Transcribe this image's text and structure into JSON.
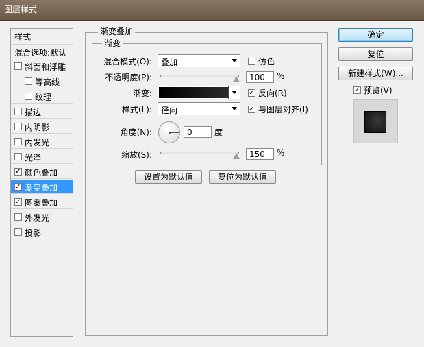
{
  "window": {
    "title": "图层样式"
  },
  "left_panel": {
    "items": [
      {
        "label": "样式",
        "type": "header"
      },
      {
        "label": "混合选项:默认",
        "type": "header"
      },
      {
        "label": "斜面和浮雕",
        "checked": false
      },
      {
        "label": "等高线",
        "checked": false,
        "indent": true
      },
      {
        "label": "纹理",
        "checked": false,
        "indent": true
      },
      {
        "label": "描边",
        "checked": false
      },
      {
        "label": "内阴影",
        "checked": false
      },
      {
        "label": "内发光",
        "checked": false
      },
      {
        "label": "光泽",
        "checked": false
      },
      {
        "label": "颜色叠加",
        "checked": true
      },
      {
        "label": "渐变叠加",
        "checked": true,
        "selected": true
      },
      {
        "label": "图案叠加",
        "checked": true
      },
      {
        "label": "外发光",
        "checked": false
      },
      {
        "label": "投影",
        "checked": false
      }
    ]
  },
  "main": {
    "group_title": "渐变叠加",
    "sub_title": "渐变",
    "blend_mode": {
      "label": "混合模式(O):",
      "value": "叠加"
    },
    "dither": {
      "label": "仿色",
      "checked": false
    },
    "opacity": {
      "label": "不透明度(P):",
      "value": "100",
      "unit": "%",
      "level": 1.0
    },
    "gradient": {
      "label": "渐变:"
    },
    "reverse": {
      "label": "反向(R)",
      "checked": true
    },
    "style": {
      "label": "样式(L):",
      "value": "径向"
    },
    "align": {
      "label": "与图层对齐(I)",
      "checked": true
    },
    "angle": {
      "label": "角度(N):",
      "value": "0",
      "unit": "度"
    },
    "scale": {
      "label": "缩放(S):",
      "value": "150",
      "unit": "%",
      "level": 1.0
    },
    "set_default": "设置为默认值",
    "reset_default": "复位为默认值"
  },
  "right_panel": {
    "ok": "确定",
    "reset": "复位",
    "new_style": "新建样式(W)...",
    "preview": {
      "label": "预览(V)",
      "checked": true
    }
  },
  "colors": {
    "title_bar": "#7a6654",
    "selection": "#3399ff",
    "background": "#f0f0f0"
  }
}
